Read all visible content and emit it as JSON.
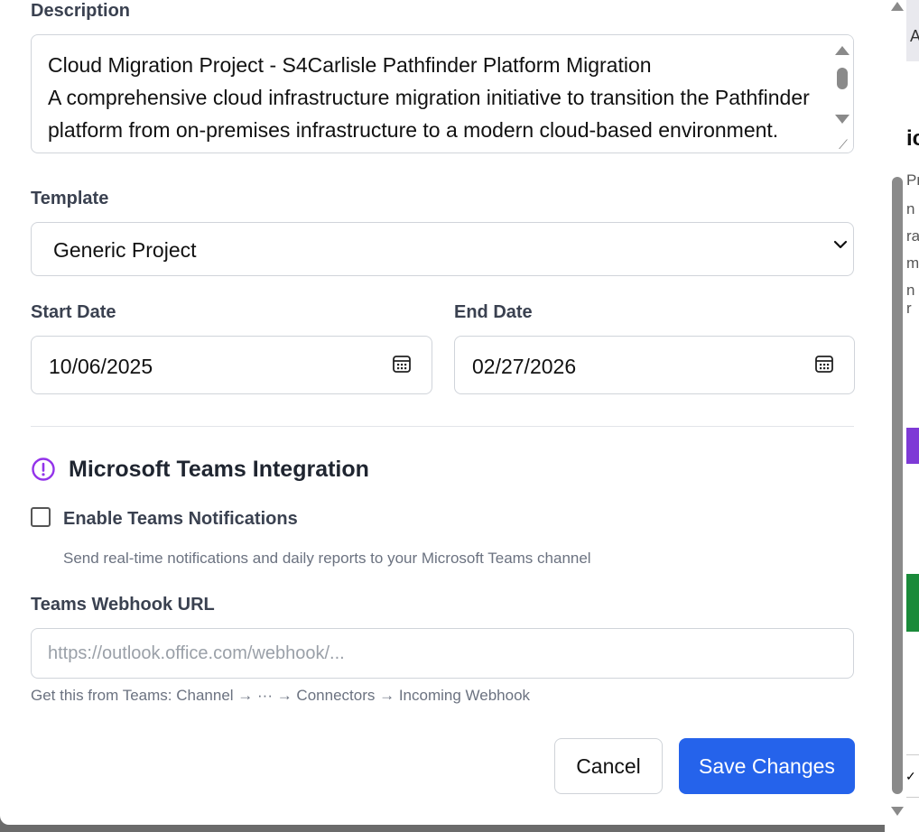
{
  "background_page": {
    "top_tab_text": "A",
    "heading_fragment": "ic",
    "text_fragments": [
      "Pr",
      "n",
      "ra",
      "m",
      "n r"
    ],
    "check_glyph": "✓"
  },
  "form": {
    "description": {
      "label": "Description",
      "value": "Cloud Migration Project - S4Carlisle Pathfinder Platform Migration\nA comprehensive cloud infrastructure migration initiative to transition the Pathfinder platform from on-premises infrastructure to a modern cloud-based environment. This project will be executed with modular, cost-aware architecture and lifecycle"
    },
    "template": {
      "label": "Template",
      "selected": "Generic Project"
    },
    "start_date": {
      "label": "Start Date",
      "value": "10/06/2025"
    },
    "end_date": {
      "label": "End Date",
      "value": "02/27/2026"
    },
    "teams": {
      "title": "Microsoft Teams Integration",
      "enable_label": "Enable Teams Notifications",
      "enabled": false,
      "help_text": "Send real-time notifications and daily reports to your Microsoft Teams channel",
      "webhook_label": "Teams Webhook URL",
      "webhook_value": "",
      "webhook_placeholder": "https://outlook.office.com/webhook/...",
      "webhook_hint": "Get this from Teams: Channel → ··· → Connectors → Incoming Webhook"
    },
    "actions": {
      "cancel_label": "Cancel",
      "save_label": "Save Changes"
    }
  },
  "colors": {
    "primary": "#2563eb",
    "teams_accent": "#9333ea",
    "text_label": "#3a4150"
  },
  "icons": {
    "teams_info": "alert-circle-icon",
    "calendar": "calendar-icon",
    "select": "chevron-down-icon"
  }
}
